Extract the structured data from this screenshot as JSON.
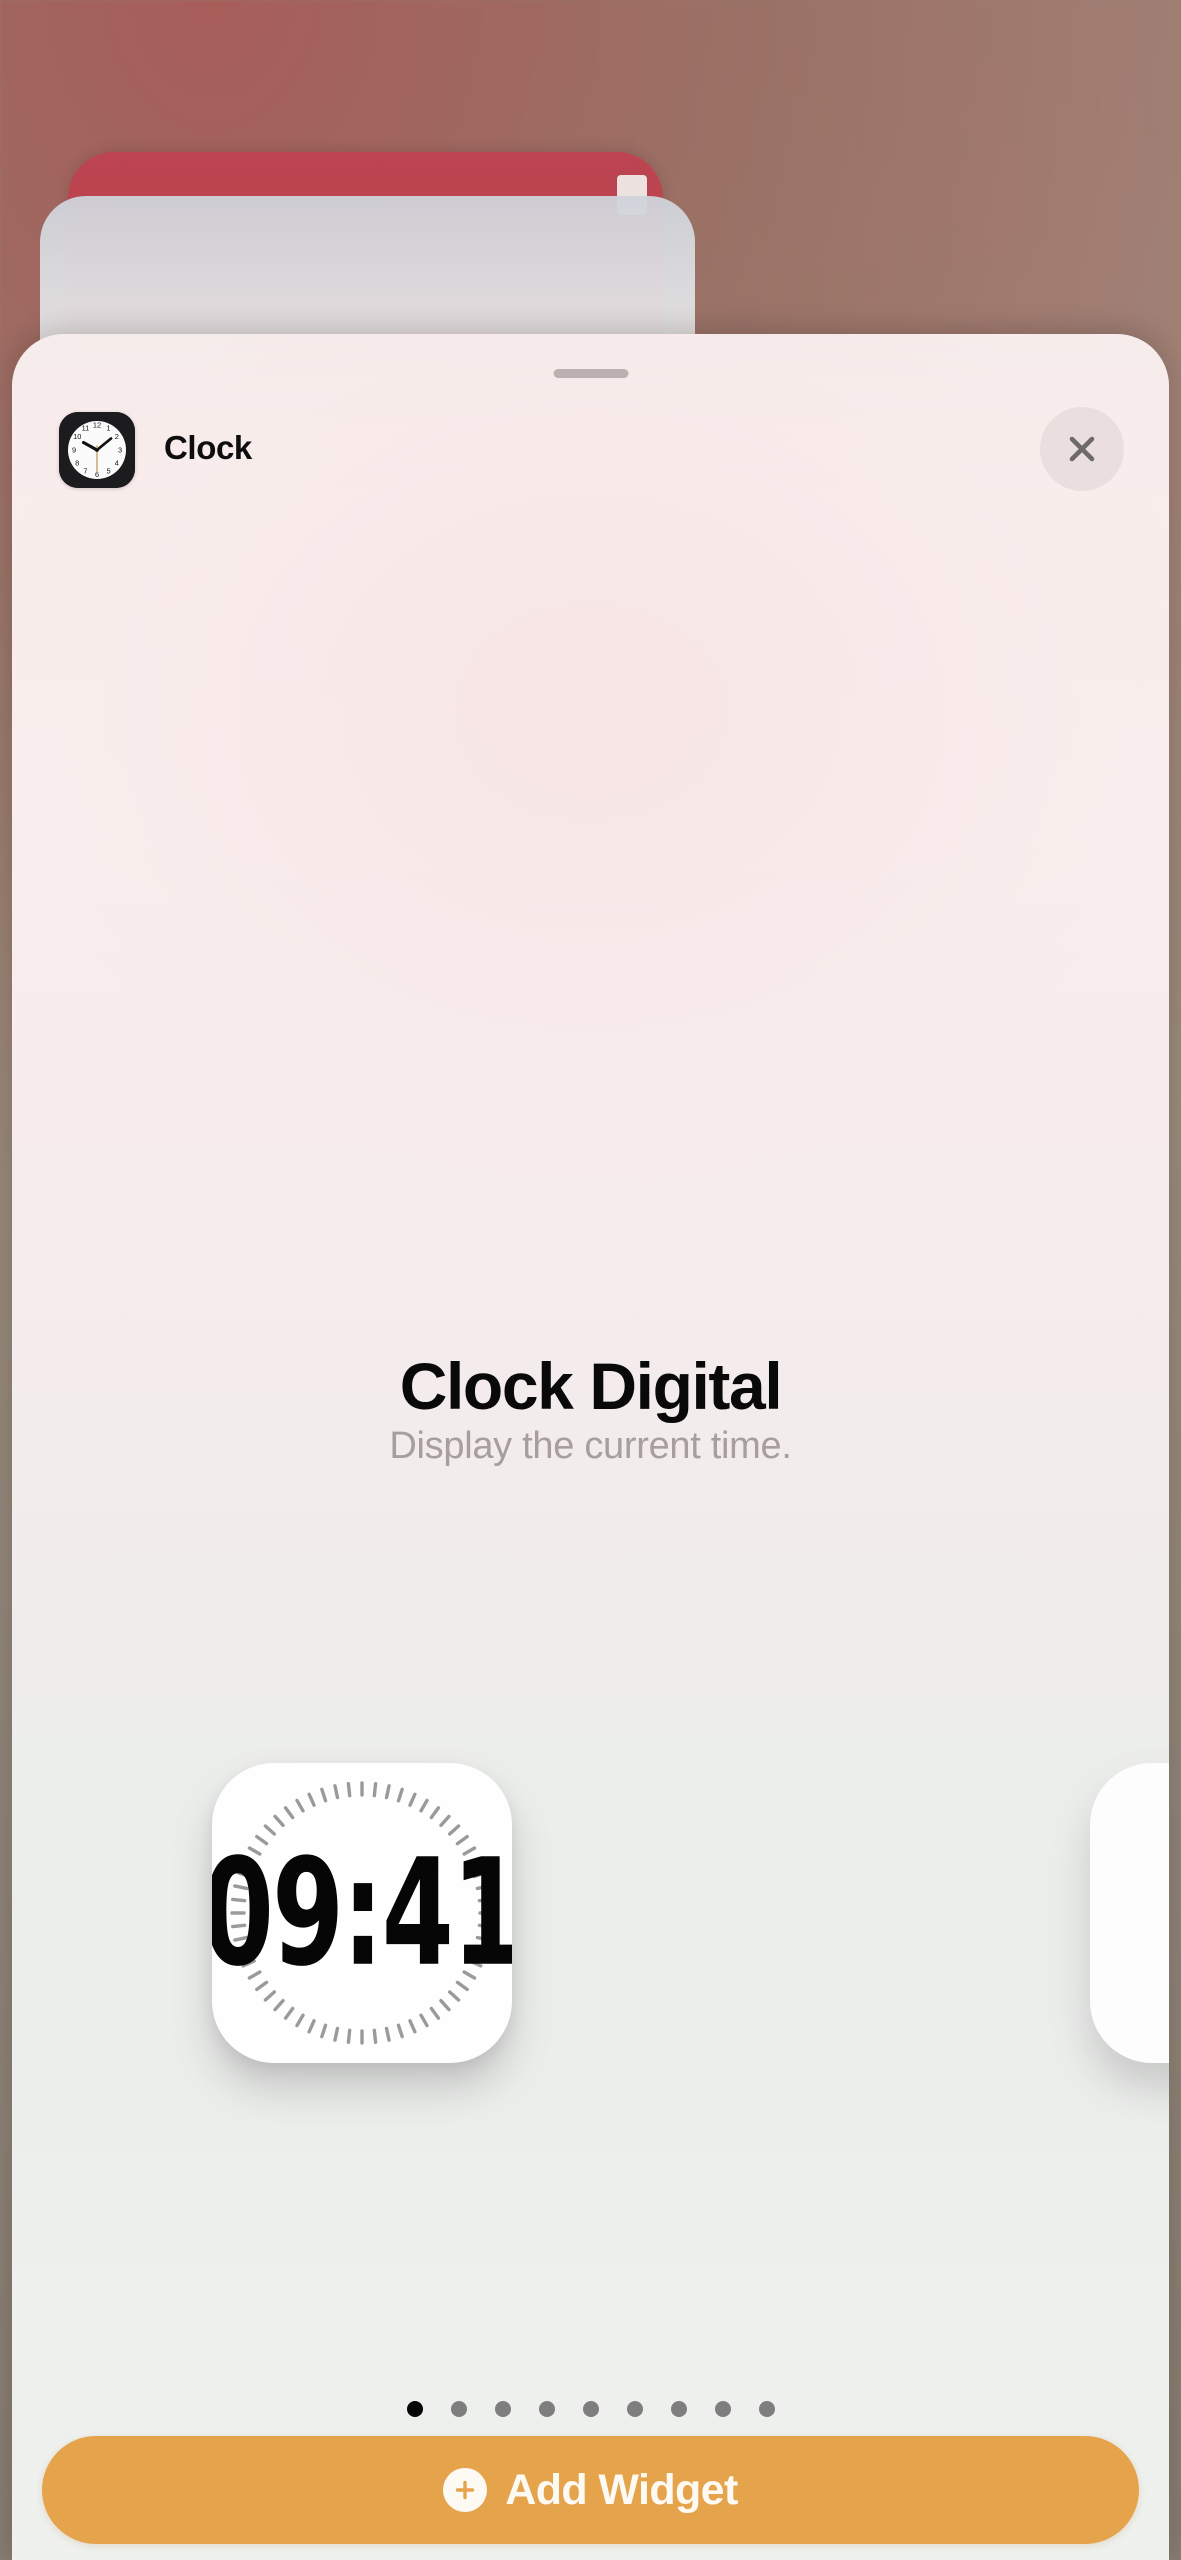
{
  "sheet": {
    "app_name": "Clock",
    "app_icon": "clock-app-icon",
    "close_icon": "close-icon",
    "grabber": "sheet-grabber"
  },
  "widget_detail": {
    "title": "Clock Digital",
    "description": "Display the current time."
  },
  "widget_preview": {
    "time": "09:41",
    "tick_count": 60,
    "card_color": "#fefefe",
    "tick_color": "#9a9a9a"
  },
  "pagination": {
    "total": 9,
    "active_index": 0,
    "active_color": "#060606",
    "inactive_color": "#7e7e7e"
  },
  "add_widget": {
    "label": "Add Widget",
    "icon": "plus-circle-icon",
    "background_color": "#e5a34c",
    "text_color": "#fdfaf4"
  },
  "theme": {
    "sheet_top_color": "#f8eeed",
    "sheet_bottom_color": "#eef0ee",
    "wallpaper_accent": "#a85c58",
    "bg_card_red": "#bd4450"
  }
}
